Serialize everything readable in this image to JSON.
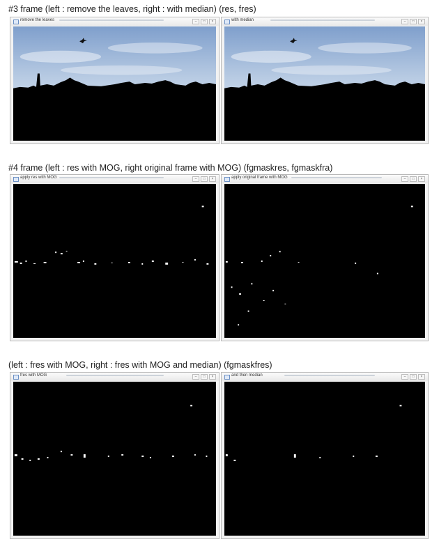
{
  "sections": [
    {
      "caption": "#3 frame (left : remove the leaves, right : with median) (res, fres)",
      "windows": [
        {
          "title": "remove the leaves",
          "view": "sky"
        },
        {
          "title": "with median",
          "view": "sky"
        }
      ]
    },
    {
      "caption": "#4 frame (left : res with MOG, right original frame with MOG) (fgmaskres, fgmaskfra)",
      "windows": [
        {
          "title": "apply res with MOG",
          "view": "mask"
        },
        {
          "title": "apply original frame with MOG",
          "view": "mask"
        }
      ]
    },
    {
      "caption": "(left : fres with MOG, right : fres with MOG and median) (fgmaskfres)",
      "windows": [
        {
          "title": "fres with MOG",
          "view": "mask"
        },
        {
          "title": "and then median",
          "view": "mask"
        }
      ]
    }
  ],
  "window_controls": {
    "minimize": "–",
    "maximize": "□",
    "close": "×"
  },
  "colors": {
    "sky_top": "#7f9fcc",
    "sky_bottom": "#e4ecf6",
    "silhouette": "#000000",
    "mask_fg": "#ffffff",
    "mask_bg": "#000000"
  },
  "icons": {
    "app": "window-app-icon",
    "bird": "bird-icon"
  }
}
